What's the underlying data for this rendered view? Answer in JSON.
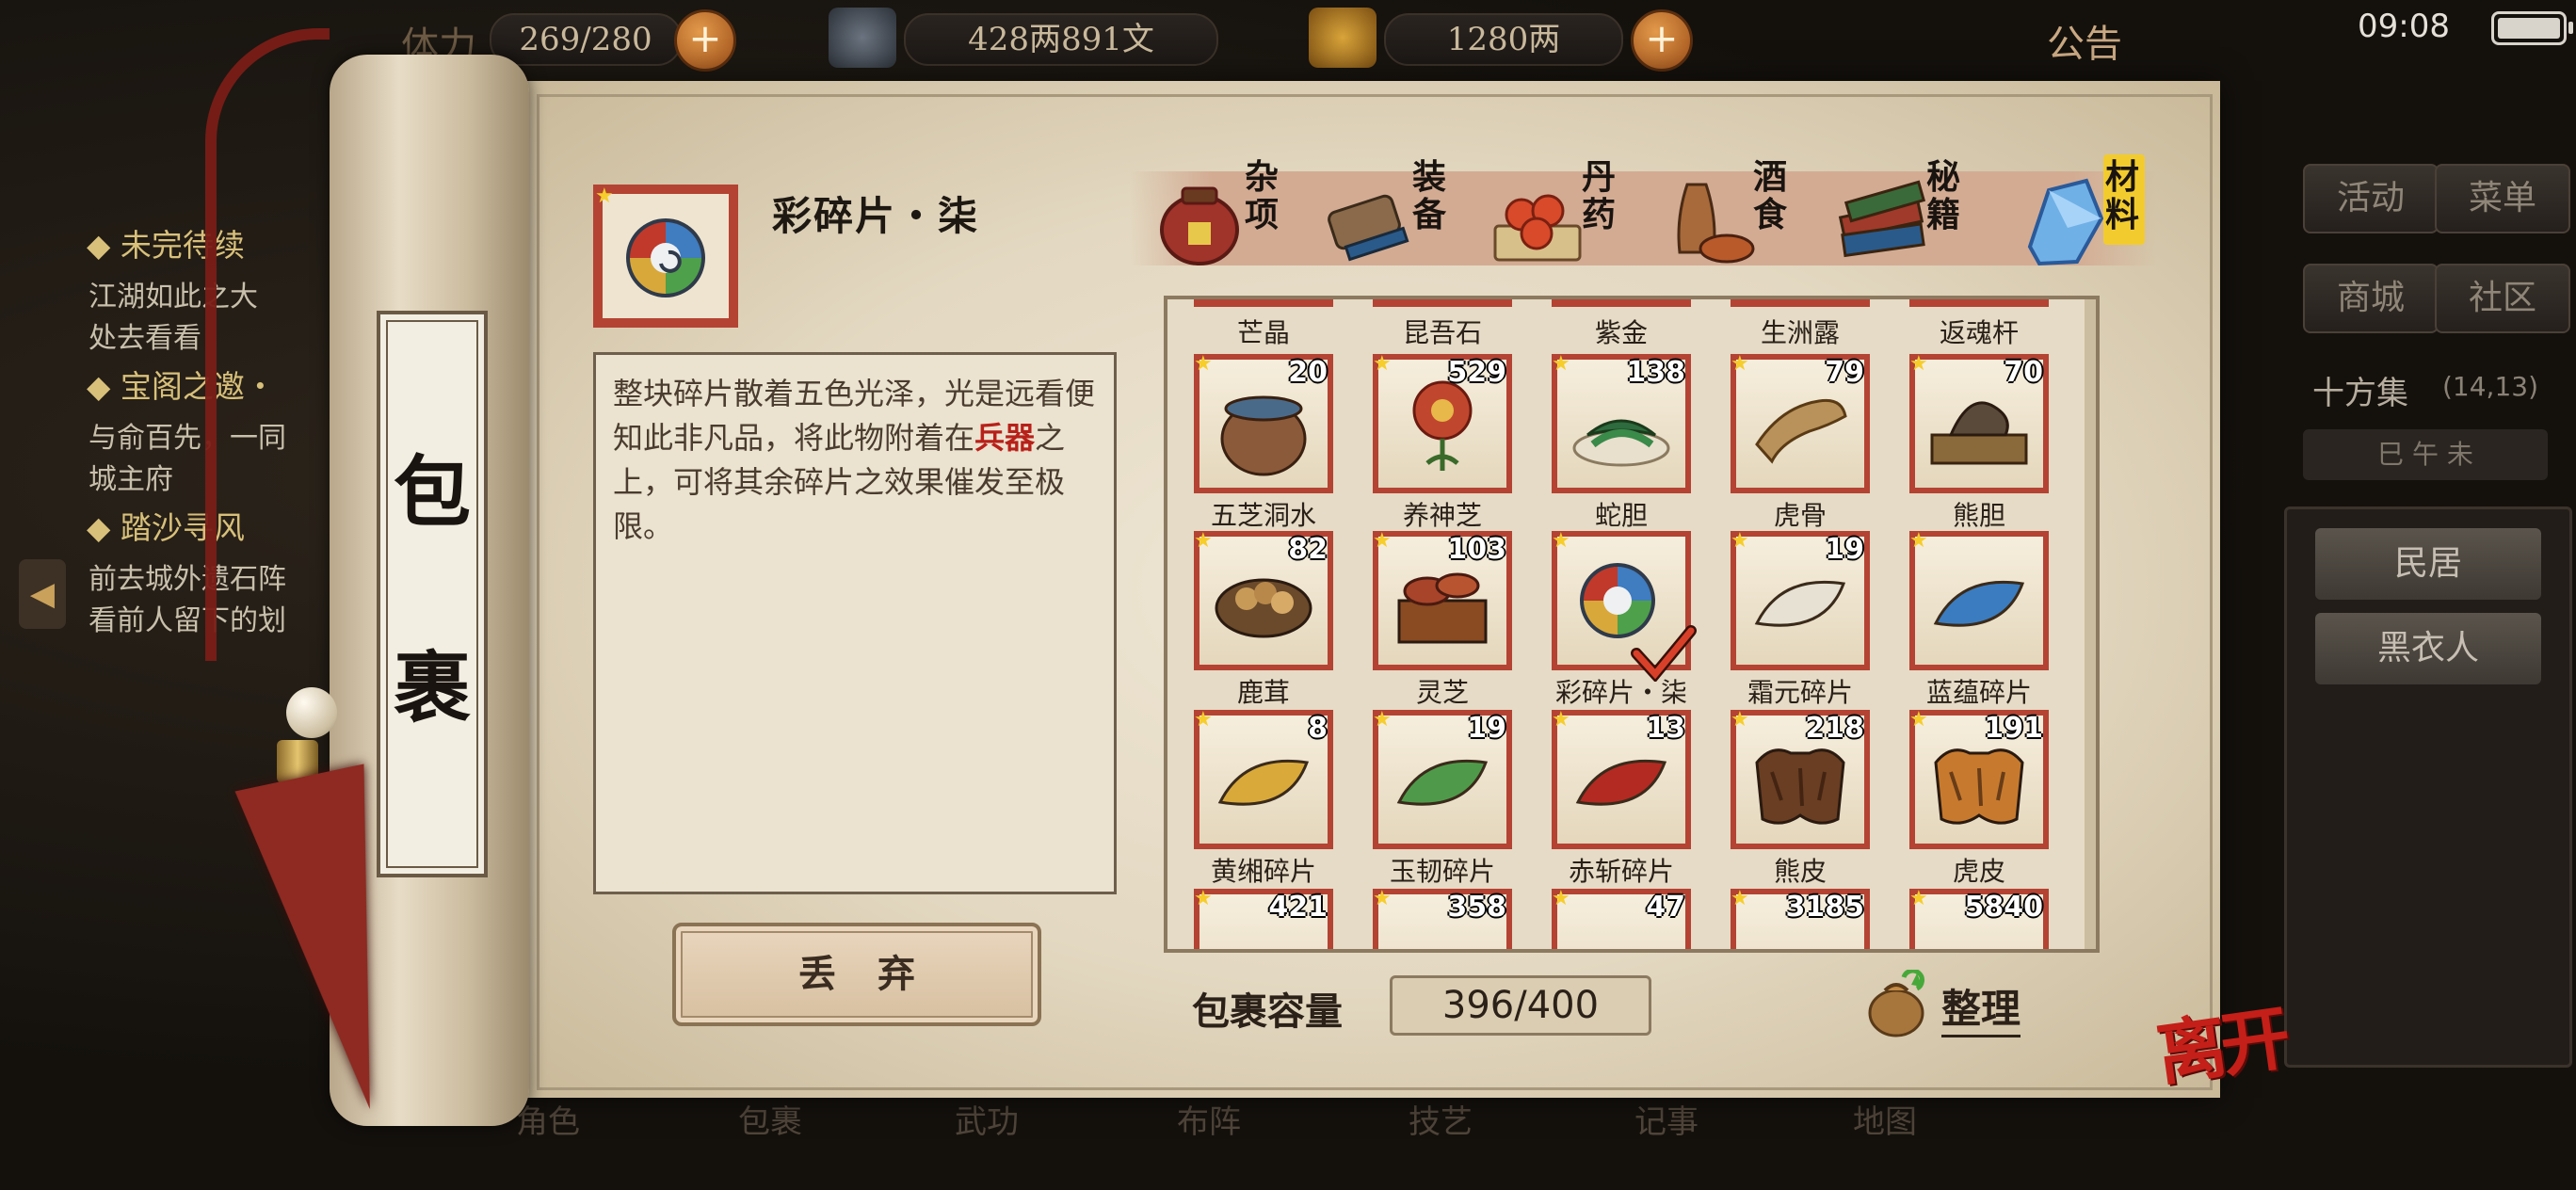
{
  "hud": {
    "stamina_label": "体力",
    "stamina": "269/280",
    "silver": "428两891文",
    "gold": "1280两",
    "announcement": "公告",
    "time": "09:08"
  },
  "quests": [
    {
      "title": "未完待续",
      "lines": [
        "江湖如此之大",
        "处去看看"
      ]
    },
    {
      "title": "宝阁之邀・",
      "lines": [
        "与俞百先，一同",
        "城主府"
      ]
    },
    {
      "title": "踏沙寻风",
      "lines": [
        "前去城外遗石阵",
        "看前人留下的划"
      ]
    }
  ],
  "side_arrow": "◀",
  "right_panel": {
    "buttons": [
      "活动",
      "菜单",
      "商城",
      "社区"
    ],
    "location": "十方集",
    "coords": "(14,13)",
    "time_of_day": "巳 午 未",
    "list": [
      "民居",
      "黑衣人"
    ]
  },
  "bottom_tabs": [
    "角色",
    "包裹",
    "武功",
    "布阵",
    "技艺",
    "记事",
    "地图"
  ],
  "bag": {
    "scroll_title_1": "包",
    "scroll_title_2": "裹",
    "selected_item": {
      "name": "彩碎片・柒",
      "description_before": "整块碎片散着五色光泽，光是远看便知此非凡品，将此物附着在",
      "description_highlight": "兵器",
      "description_after": "之上，可将其余碎片之效果催发至极限。"
    },
    "discard_label": "丢弃",
    "capacity_label": "包裹容量",
    "capacity": "396/400",
    "sort_label": "整理",
    "leave_label": "离开"
  },
  "categories": [
    {
      "label": "杂项",
      "icon": "jar-icon",
      "active": false
    },
    {
      "label": "装备",
      "icon": "equipment-icon",
      "active": false
    },
    {
      "label": "丹药",
      "icon": "pill-icon",
      "active": false
    },
    {
      "label": "酒食",
      "icon": "food-icon",
      "active": false
    },
    {
      "label": "秘籍",
      "icon": "book-icon",
      "active": false
    },
    {
      "label": "材料",
      "icon": "crystal-icon",
      "active": true
    }
  ],
  "top_row_names": [
    "芒晶",
    "昆吾石",
    "紫金",
    "生洲露",
    "返魂杆"
  ],
  "items": [
    {
      "name": "五芝洞水",
      "count": "20",
      "art": "pot",
      "color": "#8a5a3a"
    },
    {
      "name": "养神芝",
      "count": "529",
      "art": "flower",
      "color": "#c0472d"
    },
    {
      "name": "蛇胆",
      "count": "138",
      "art": "herb",
      "color": "#2e6b3e"
    },
    {
      "name": "虎骨",
      "count": "79",
      "art": "bone",
      "color": "#b8925a"
    },
    {
      "name": "熊胆",
      "count": "70",
      "art": "tray",
      "color": "#5a4a3a"
    },
    {
      "name": "鹿茸",
      "count": "82",
      "art": "bowl",
      "color": "#9a6a38"
    },
    {
      "name": "灵芝",
      "count": "103",
      "art": "box",
      "color": "#8a4a22"
    },
    {
      "name": "彩碎片・柒",
      "count": "",
      "art": "orb",
      "color": "#3a6ea5",
      "selected": true
    },
    {
      "name": "霜元碎片",
      "count": "19",
      "art": "leaf",
      "color": "#e6e1d3"
    },
    {
      "name": "蓝蕴碎片",
      "count": "",
      "art": "leaf",
      "color": "#3b7cc0"
    },
    {
      "name": "黄缃碎片",
      "count": "8",
      "art": "leaf",
      "color": "#d9a93a"
    },
    {
      "name": "玉韧碎片",
      "count": "19",
      "art": "leaf",
      "color": "#4f9a4a"
    },
    {
      "name": "赤斩碎片",
      "count": "13",
      "art": "leaf",
      "color": "#b32a22"
    },
    {
      "name": "熊皮",
      "count": "218",
      "art": "pelt",
      "color": "#6a3e22"
    },
    {
      "name": "虎皮",
      "count": "191",
      "art": "pelt",
      "color": "#c77a2e"
    },
    {
      "name": "",
      "count": "421",
      "art": "partial",
      "color": "#8a5a3a"
    },
    {
      "name": "",
      "count": "358",
      "art": "partial",
      "color": "#7a4a2a"
    },
    {
      "name": "",
      "count": "47",
      "art": "partial",
      "color": "#9a6a38"
    },
    {
      "name": "",
      "count": "3185",
      "art": "partial",
      "color": "#6a8aa8"
    },
    {
      "name": "",
      "count": "5840",
      "art": "partial",
      "color": "#8a8a80"
    }
  ]
}
